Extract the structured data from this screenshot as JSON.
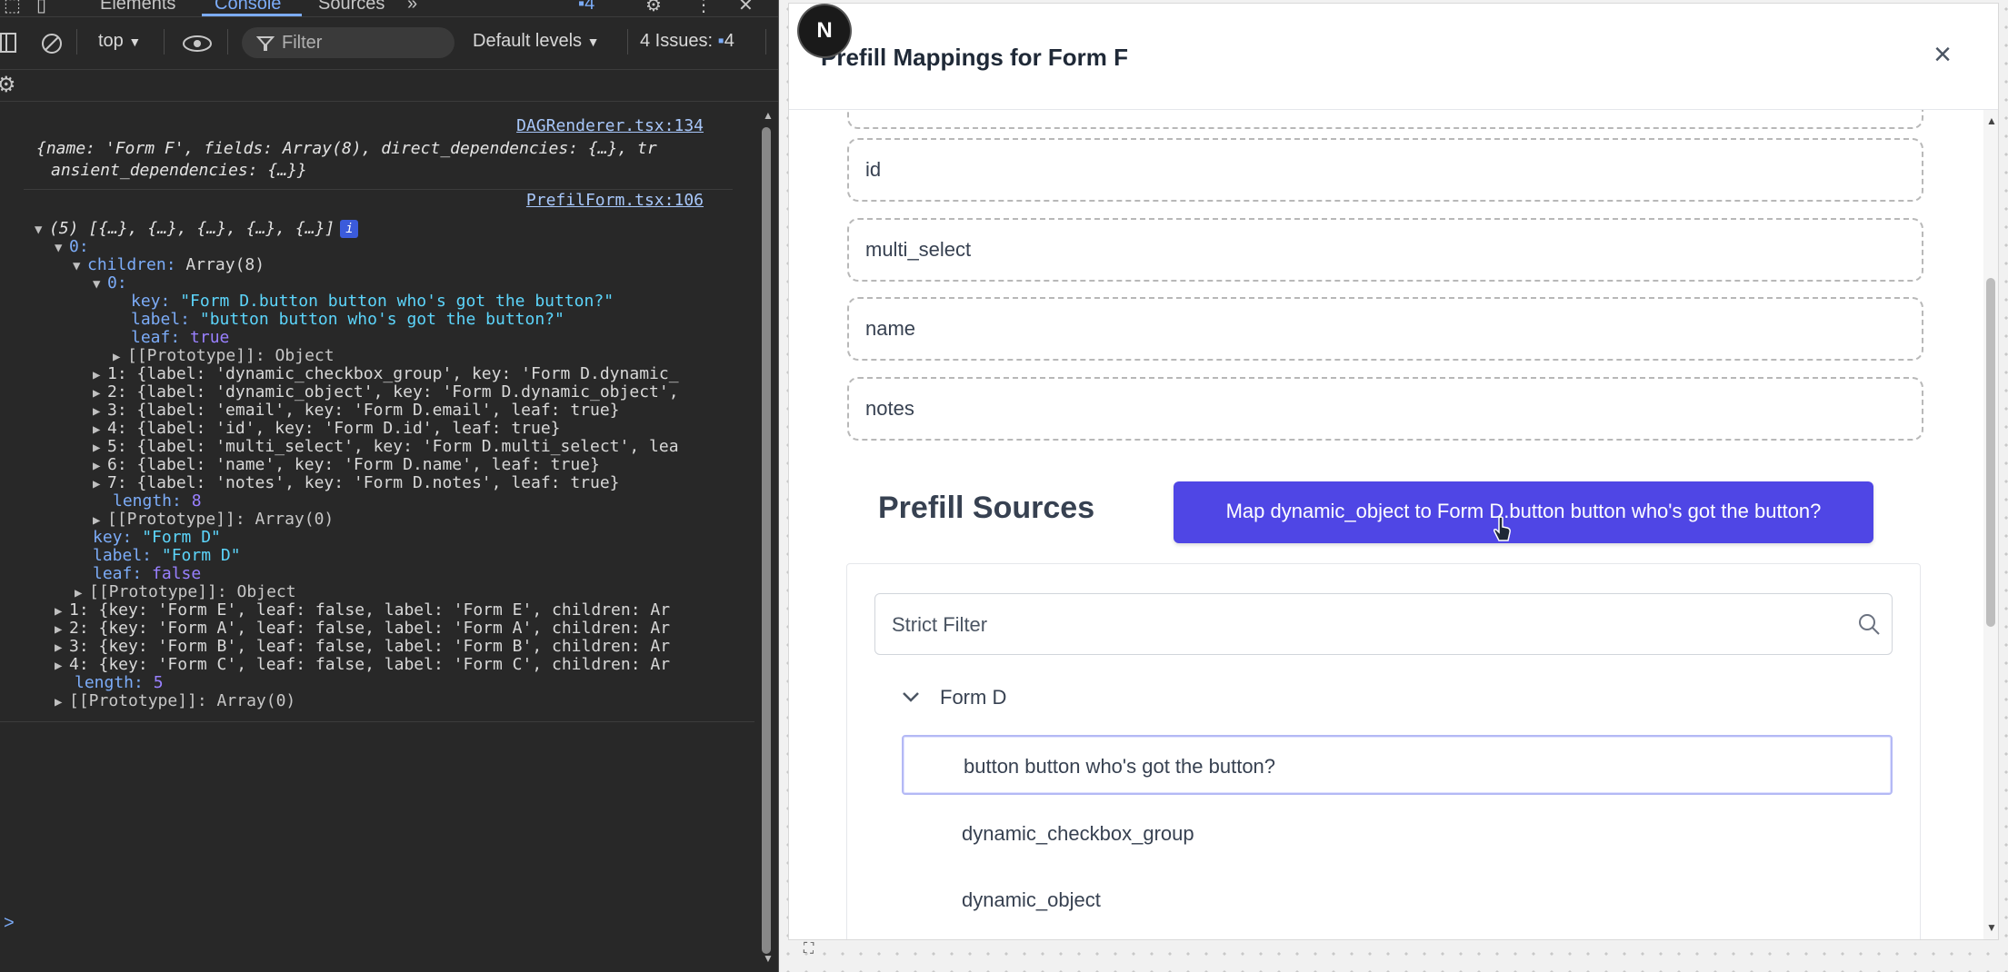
{
  "devtools": {
    "tabs": [
      "Elements",
      "Console",
      "Sources"
    ],
    "issues_badge": "4",
    "toolbar": {
      "context": "top",
      "filter_placeholder": "Filter",
      "levels": "Default levels",
      "issues_label": "4 Issues:",
      "issues_count": "4"
    },
    "console": {
      "source1": "DAGRenderer.tsx:134",
      "log1_line1": "{name: 'Form F', fields: Array(8), direct_dependencies: {…}, tr",
      "log1_line2": "ansient_dependencies: {…}}",
      "source2": "PrefilForm.tsx:106",
      "log2_summary": "(5) [{…}, {…}, {…}, {…}, {…}]",
      "info_badge": "i",
      "idx0": "0:",
      "children_label": "children:",
      "children_val": "Array(8)",
      "child0": "0:",
      "key_label": "key:",
      "key_val": "\"Form D.button button who's got the button?\"",
      "label_label": "label:",
      "label_val": "\"button button who's got the button?\"",
      "leaf_label": "leaf:",
      "leaf_val": "true",
      "proto_obj": "[[Prototype]]: Object",
      "children_rows": [
        "1: {label: 'dynamic_checkbox_group', key: 'Form D.dynamic_",
        "2: {label: 'dynamic_object', key: 'Form D.dynamic_object',",
        "3: {label: 'email', key: 'Form D.email', leaf: true}",
        "4: {label: 'id', key: 'Form D.id', leaf: true}",
        "5: {label: 'multi_select', key: 'Form D.multi_select', lea",
        "6: {label: 'name', key: 'Form D.name', leaf: true}",
        "7: {label: 'notes', key: 'Form D.notes', leaf: true}"
      ],
      "length_label": "length:",
      "length8": "8",
      "proto_arr": "[[Prototype]]: Array(0)",
      "key_d": "\"Form D\"",
      "label_d": "\"Form D\"",
      "leaf_false": "false",
      "outer_rows": [
        "1: {key: 'Form E', leaf: false, label: 'Form E', children: Ar",
        "2: {key: 'Form A', leaf: false, label: 'Form A', children: Ar",
        "3: {key: 'Form B', leaf: false, label: 'Form B', children: Ar",
        "4: {key: 'Form C', leaf: false, label: 'Form C', children: Ar"
      ],
      "length5": "5",
      "prompt": ">"
    }
  },
  "modal": {
    "logo_letter": "N",
    "title": "Prefill Mappings for Form F",
    "close": "×",
    "fields": [
      "id",
      "multi_select",
      "name",
      "notes"
    ],
    "sources_heading": "Prefill Sources",
    "map_button": "Map dynamic_object to Form D.button button who's got the button?",
    "filter_placeholder": "Strict Filter",
    "group": "Form D",
    "items": [
      "button button who's got the button?",
      "dynamic_checkbox_group",
      "dynamic_object"
    ]
  }
}
